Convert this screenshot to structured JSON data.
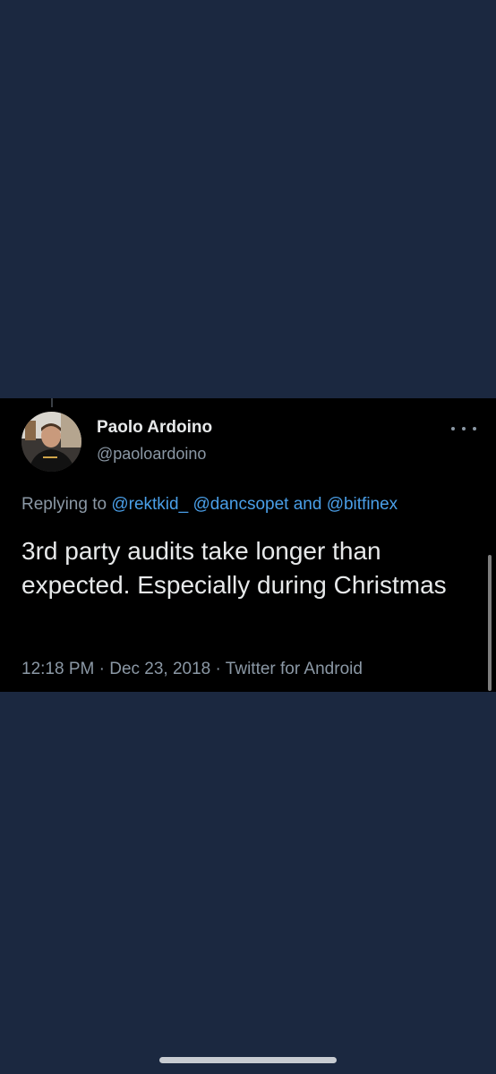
{
  "tweet": {
    "display_name": "Paolo Ardoino",
    "handle": "@paoloardoino",
    "replying_prefix": "Replying to",
    "mentions": [
      "@rektkid_",
      "@dancsopet",
      "@bitfinex"
    ],
    "mention_joiner": "and",
    "text": "3rd party audits take longer than expected. Especially during Christmas",
    "time": "12:18 PM",
    "date": "Dec 23, 2018",
    "source": "Twitter for Android",
    "separator": "·"
  },
  "icons": {
    "more": "more-options-icon",
    "avatar": "profile-avatar"
  },
  "colors": {
    "page_background": "#1b2840",
    "card_background": "#000000",
    "primary_text": "#e7e9ea",
    "secondary_text": "#8b98a5",
    "link": "#4a9fe8"
  }
}
